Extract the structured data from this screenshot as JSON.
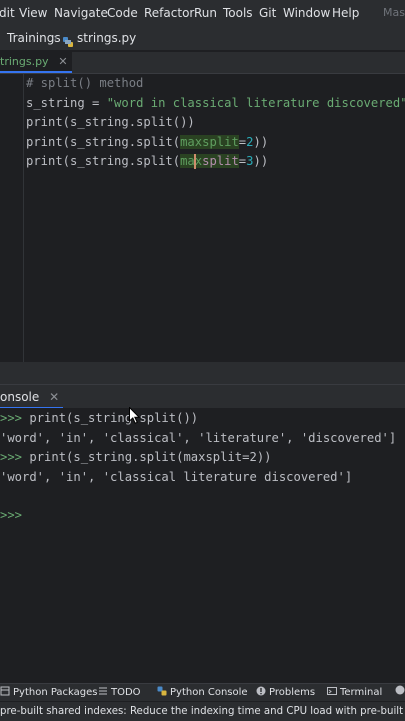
{
  "menu": [
    "dit",
    "View",
    "Navigate",
    "Code",
    "Refactor",
    "Run",
    "Tools",
    "Git",
    "Window",
    "Help"
  ],
  "app_title": "Mas",
  "breadcrumb": {
    "project": "Trainings",
    "file": "strings.py"
  },
  "tab": {
    "label": "trings.py"
  },
  "editor": {
    "lines": [
      {
        "comment": "# split() method"
      },
      {
        "var": "s_string = ",
        "string": "\"word in classical literature discovered\""
      },
      {
        "pre": "print(s_string.split())"
      },
      {
        "pre": "print(s_string.split(",
        "param": "maxsplit",
        "eq": "=",
        "num": "2",
        "post": "))"
      },
      {
        "pre": "print(s_string.split(",
        "param_a": "max",
        "param_b": "split",
        "eq": "=",
        "num": "3",
        "post": "))"
      }
    ]
  },
  "console": {
    "tab_label": "onsole",
    "lines": [
      {
        "prompt": ">>>",
        "text": " print(s_string.split())"
      },
      {
        "text": "'word', 'in', 'classical', 'literature', 'discovered']"
      },
      {
        "prompt": ">>>",
        "text": " print(s_string.split(maxsplit=2))"
      },
      {
        "text": "'word', 'in', 'classical literature discovered']"
      },
      {
        "prompt": ">>>",
        "text": ""
      }
    ]
  },
  "toolwindows": [
    "Python Packages",
    "TODO",
    "Python Console",
    "Problems",
    "Terminal"
  ],
  "status": "pre-built shared indexes: Reduce the indexing time and CPU load with pre-built Python"
}
